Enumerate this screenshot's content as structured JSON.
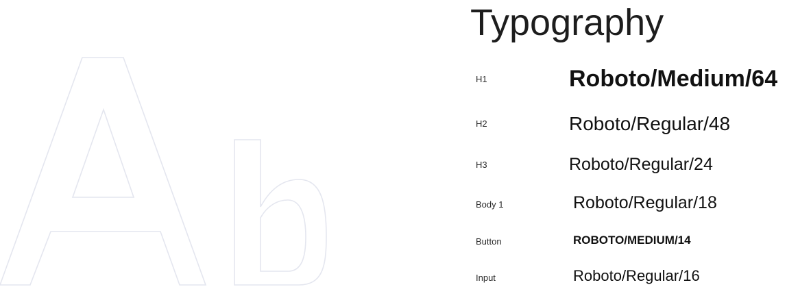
{
  "title": "Typography",
  "specimen": {
    "glyphs": [
      "A",
      "b"
    ],
    "stroke_color": "#e4e6ef"
  },
  "styles": [
    {
      "label": "H1",
      "sample": "Roboto/Medium/64"
    },
    {
      "label": "H2",
      "sample": "Roboto/Regular/48"
    },
    {
      "label": "H3",
      "sample": "Roboto/Regular/24"
    },
    {
      "label": "Body 1",
      "sample": "Roboto/Regular/18"
    },
    {
      "label": "Button",
      "sample": "ROBOTO/MEDIUM/14"
    },
    {
      "label": "Input",
      "sample": "Roboto/Regular/16"
    }
  ]
}
